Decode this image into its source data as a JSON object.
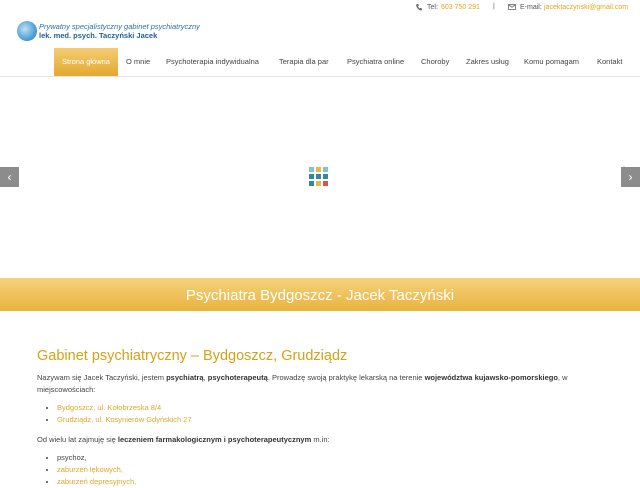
{
  "topbar": {
    "tel_label": "Tel:",
    "tel_value": "603 750 291",
    "separator": "|",
    "email_label": "E-mail:",
    "email_value": "jacektaczynski@gmail.com"
  },
  "logo": {
    "line1": "Prywatny specjalistyczny gabinet psychiatryczny",
    "line2": "lek. med. psych. Taczyński Jacek"
  },
  "nav": {
    "items": [
      "Strona główna",
      "O mnie",
      "Psychoterapia indywidualna",
      "Terapia dla par",
      "Psychiatra online",
      "Choroby",
      "Zakres usług",
      "Komu pomagam",
      "Kontakt"
    ],
    "active_index": 0
  },
  "slider": {
    "pause_icon": "⏸",
    "prev_arrow": "‹",
    "next_arrow": "›",
    "loader_colors": [
      "#7fc4d6",
      "#e8b93f",
      "#7fc4d6",
      "#2e8ba0",
      "#2e8ba0",
      "#2e8ba0",
      "#2e8ba0",
      "#e8b93f",
      "#d9534f"
    ]
  },
  "banner": {
    "title": "Psychiatra Bydgoszcz - Jacek Taczyński"
  },
  "content": {
    "heading": "Gabinet psychiatryczny – Bydgoszcz, Grudziądz",
    "intro_1": "Nazywam się Jacek Taczyński, jestem ",
    "intro_bold_1": "psychiatrą",
    "intro_2": ", ",
    "intro_bold_2": "psychoterapeutą",
    "intro_3": ". Prowadzę swoją praktykę lekarską na terenie ",
    "intro_bold_3": "województwa kujawsko-pomorskiego",
    "intro_4": ", w miejscowościach:",
    "locations": [
      "Bydgoszcz, ul. Kołobrzeska 8/4",
      "Grudziądz, ul. Kosynierów Gdyńskich 27"
    ],
    "treat_1": "Od wielu lat zajmuję się ",
    "treat_bold": "leczeniem farmakologicznym i  psychoterapeutycznym",
    "treat_2": "  m.in:",
    "conditions": [
      "psychoz,",
      "zaburzeń lękowych,",
      "zaburzeń depresyjnych,"
    ]
  }
}
